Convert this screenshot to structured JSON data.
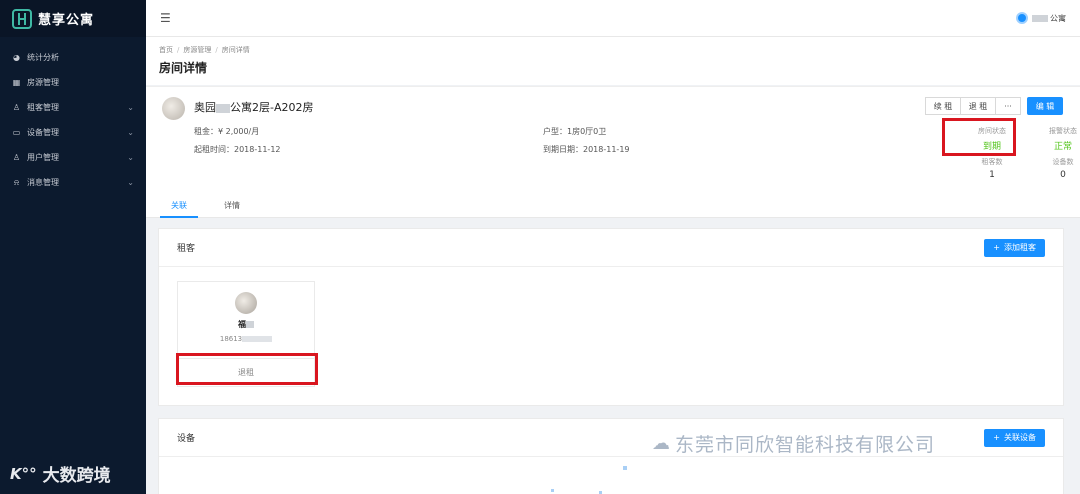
{
  "app": {
    "name": "慧享公寓"
  },
  "sidebar": {
    "items": [
      {
        "label": "统计分析",
        "icon": "pie-chart-icon",
        "glyph": "◕",
        "expandable": false
      },
      {
        "label": "房源管理",
        "icon": "building-icon",
        "glyph": "▦",
        "expandable": false
      },
      {
        "label": "租客管理",
        "icon": "user-icon",
        "glyph": "♙",
        "expandable": true
      },
      {
        "label": "设备管理",
        "icon": "monitor-icon",
        "glyph": "▭",
        "expandable": true
      },
      {
        "label": "用户管理",
        "icon": "user-icon",
        "glyph": "♙",
        "expandable": true
      },
      {
        "label": "消息管理",
        "icon": "bell-icon",
        "glyph": "⍾",
        "expandable": true
      }
    ]
  },
  "watermark_left": {
    "logo": "K°°",
    "text": "大数跨境"
  },
  "topbar": {
    "user_suffix": "公寓"
  },
  "breadcrumb": [
    "首页",
    "房源管理",
    "房间详情"
  ],
  "page": {
    "title": "房间详情"
  },
  "room": {
    "name_prefix": "奥园",
    "name_suffix": "公寓2层-A202房",
    "rent_label": "租金：",
    "rent_value": "¥ 2,000/月",
    "start_label": "起租时间：",
    "start_value": "2018-11-12",
    "layout_label": "户型：",
    "layout_value": "1房0厅0卫",
    "end_label": "到期日期：",
    "end_value": "2018-11-19"
  },
  "actions": {
    "renew": "续 租",
    "checkout": "退 租",
    "more": "···",
    "edit": "编 辑"
  },
  "stats": {
    "room_status_label": "房间状态",
    "room_status_value": "到期",
    "alarm_status_label": "报警状态",
    "alarm_status_value": "正常",
    "tenant_count_label": "租客数",
    "tenant_count_value": "1",
    "device_count_label": "设备数",
    "device_count_value": "0"
  },
  "tabs": [
    {
      "label": "关联",
      "active": true
    },
    {
      "label": "详情",
      "active": false
    }
  ],
  "tenants_card": {
    "title": "租客",
    "add_label": "添加租客"
  },
  "tenant": {
    "name_prefix": "福",
    "phone_prefix": "18613",
    "action": "退租"
  },
  "devices_card": {
    "title": "设备",
    "add_label": "关联设备"
  },
  "watermark_right": {
    "text": "东莞市同欣智能科技有限公司"
  },
  "colors": {
    "primary": "#1890ff",
    "sidebar": "#0c1a2e",
    "highlight": "#d9161f",
    "success": "#52c41a"
  }
}
